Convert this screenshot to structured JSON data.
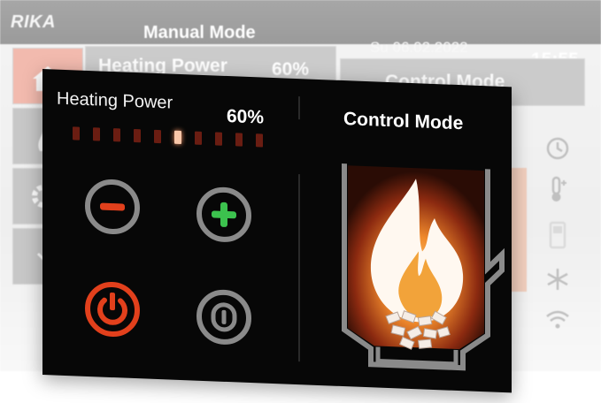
{
  "background": {
    "brand_logo": "RIKA",
    "mode_title": "Manual Mode",
    "date": "Su 06.02.2022",
    "time": "15:55",
    "heating_power_label": "Heating Power",
    "heating_power_value": "60%",
    "control_mode_label": "Control Mode",
    "sidebar_icons": [
      "home-icon",
      "flame-icon",
      "gear-icon",
      "chevron-icon"
    ],
    "right_icons": [
      "clock-icon",
      "thermometer-plus-icon",
      "phone-icon",
      "snowflake-icon",
      "wifi-icon"
    ]
  },
  "panel": {
    "heating_power_label": "Heating Power",
    "heating_power_value": "60%",
    "control_mode_label": "Control Mode",
    "power_level": {
      "segments": 10,
      "active_segment": 6
    },
    "buttons": [
      "minus-button",
      "plus-button",
      "power-button",
      "standby-button"
    ]
  },
  "colors": {
    "panel_bg": "#070707",
    "accent_red": "#e2401c",
    "accent_green": "#3cc24e",
    "ring_gray": "#8a8a8a",
    "flame_orange": "#f08a2c",
    "inactive_segment": "#6a1d12",
    "active_segment": "#f9c6a8"
  }
}
